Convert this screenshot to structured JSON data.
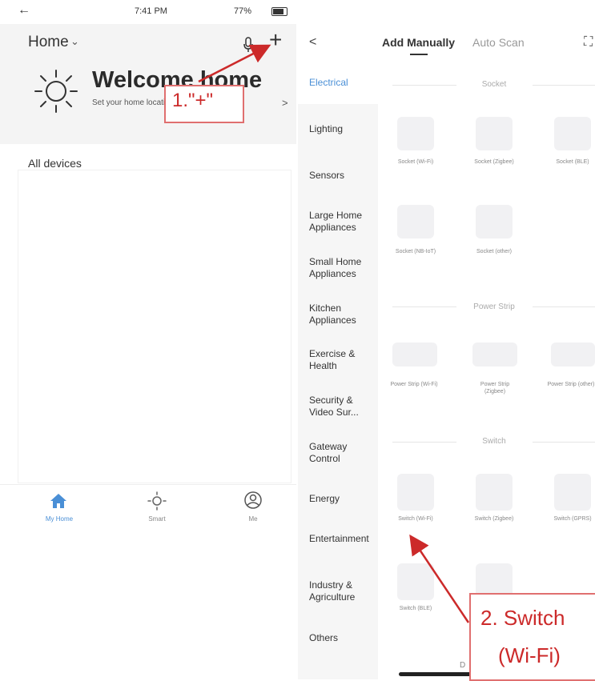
{
  "left_screen": {
    "status": {
      "time": "7:41 PM",
      "battery": "77%",
      "back_glyph": "←"
    },
    "header": {
      "home_title": "Home",
      "chevron": "⌄",
      "add_glyph": "+"
    },
    "welcome": {
      "title": "Welcome home",
      "subtitle": "Set your home location for more...",
      "arrow": ">"
    },
    "devices": {
      "heading": "All devices"
    },
    "tabs": [
      {
        "label": "My Home",
        "icon": "home-icon",
        "active": true
      },
      {
        "label": "Smart",
        "icon": "sun-icon",
        "active": false
      },
      {
        "label": "Me",
        "icon": "user-icon",
        "active": false
      }
    ]
  },
  "right_screen": {
    "header": {
      "back_glyph": "<",
      "tab_manual": "Add Manually",
      "tab_auto": "Auto Scan",
      "scan_glyph": "⛶"
    },
    "categories": [
      "Electrical",
      "Lighting",
      "Sensors",
      "Large Home Appliances",
      "Small Home Appliances",
      "Kitchen Appliances",
      "Exercise & Health",
      "Security & Video Sur...",
      "Gateway Control",
      "Energy",
      "Entertainment",
      "Industry & Agriculture",
      "Others"
    ],
    "sections": {
      "socket": {
        "title": "Socket",
        "devices": [
          "Socket (Wi-Fi)",
          "Socket (Zigbee)",
          "Socket (BLE)",
          "Socket (NB-IoT)",
          "Socket (other)"
        ]
      },
      "power_strip": {
        "title": "Power Strip",
        "devices": [
          "Power Strip (Wi-Fi)",
          "Power Strip (Zigbee)",
          "Power Strip (other)"
        ]
      },
      "switch": {
        "title": "Switch",
        "devices": [
          "Switch (Wi-Fi)",
          "Switch (Zigbee)",
          "Switch (GPRS)",
          "Switch (BLE)",
          ""
        ]
      }
    },
    "bottom_hint": "D"
  },
  "annotations": {
    "step1": "1.\"+\"",
    "step2_line1": "2. Switch",
    "step2_line2": "(Wi-Fi)"
  },
  "colors": {
    "accent": "#4a8fd6",
    "annotation_red": "#cc2a2a"
  }
}
